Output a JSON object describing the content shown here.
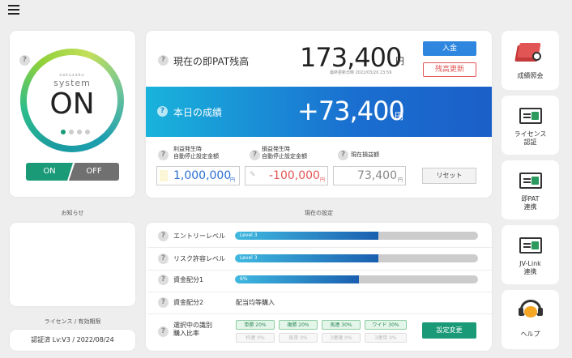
{
  "menu": {
    "icon": "hamburger-menu-icon"
  },
  "power": {
    "brand_small": "zakuzaku",
    "brand": "system",
    "state": "ON",
    "toggle_on": "ON",
    "toggle_off": "OFF",
    "help": "?"
  },
  "balance": {
    "label": "現在の即PAT残高",
    "value": "173,400",
    "unit": "円",
    "updated": "最終更新日時 2022/03/20 23:59",
    "deposit_button": "入金",
    "refresh_button": "残高更新",
    "help": "?"
  },
  "today": {
    "label": "本日の成績",
    "value": "+73,400",
    "unit": "円",
    "help": "?"
  },
  "stop": {
    "profit_label_1": "利益発生時",
    "profit_label_2": "自動停止設定金額",
    "profit_value": "1,000,000",
    "profit_unit": "円",
    "loss_label_1": "損益発生時",
    "loss_label_2": "自動停止設定金額",
    "loss_value": "-100,000",
    "loss_unit": "円",
    "current_label": "現在損益額",
    "current_value": "73,400",
    "current_unit": "円",
    "reset_button": "リセット",
    "help": "?"
  },
  "notice": {
    "title": "お知らせ"
  },
  "license": {
    "title": "ライセンス / 有効期限",
    "value": "認証済 Lv:V3 / 2022/08/24"
  },
  "settings": {
    "title": "現在の設定",
    "entry": {
      "label": "エントリーレベル",
      "bar_text": "Level 3",
      "level": 0.59
    },
    "risk": {
      "label": "リスク許容レベル",
      "bar_text": "Level 3",
      "level": 0.59
    },
    "alloc1": {
      "label": "資金配分1",
      "bar_text": "6%",
      "level": 0.51
    },
    "alloc2": {
      "label": "資金配分2",
      "value": "配当均等購入"
    },
    "ratio": {
      "label_1": "選択中の識別",
      "label_2": "購入比率",
      "chips_on": [
        "単勝 20%",
        "複勝 20%",
        "馬連 30%",
        "ワイド 30%"
      ],
      "chips_off": [
        "枠連 0%",
        "馬単 0%",
        "3連複 0%",
        "3連単 0%"
      ],
      "change_button": "設定変更"
    }
  },
  "sidebar": {
    "items": [
      {
        "label_1": "成績照会",
        "label_2": "",
        "icon": "book-search-icon"
      },
      {
        "label_1": "ライセンス",
        "label_2": "認証",
        "icon": "id-card-icon"
      },
      {
        "label_1": "即PAT",
        "label_2": "連携",
        "icon": "id-card-icon"
      },
      {
        "label_1": "JV-Link",
        "label_2": "連携",
        "icon": "id-card-icon"
      },
      {
        "label_1": "ヘルプ",
        "label_2": "",
        "icon": "headset-help-icon"
      }
    ]
  },
  "colors": {
    "accent_blue": "#1a6fd0",
    "green": "#1a9a77",
    "red": "#e25555"
  }
}
